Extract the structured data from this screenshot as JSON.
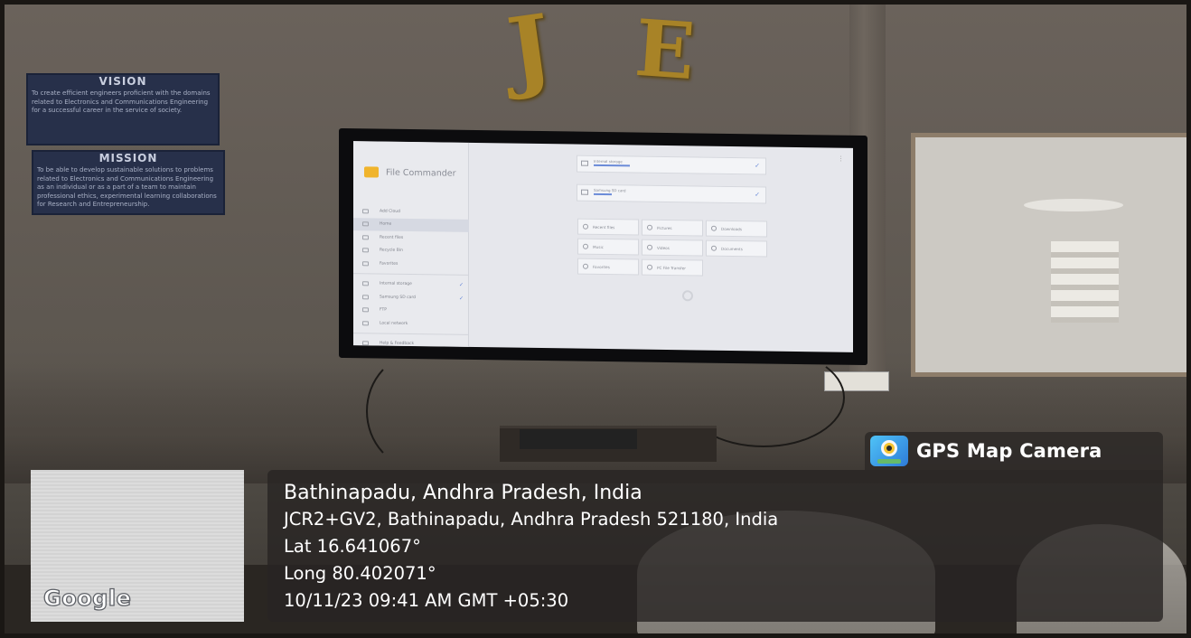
{
  "scene": {
    "balloons": [
      "J",
      "E"
    ],
    "vision_board": {
      "title": "VISION",
      "text": "To create efficient engineers proficient with the domains related to Electronics and Communications Engineering for a successful career in the service of society."
    },
    "mission_board": {
      "title": "MISSION",
      "text": "To be able to develop sustainable solutions to problems related to Electronics and Communications Engineering as an individual or as a part of a team to maintain professional ethics, experimental learning collaborations for Research and Entrepreneurship."
    }
  },
  "tv_screen": {
    "app_title": "File Commander",
    "sidebar": [
      {
        "label": "Add Cloud",
        "icon": "cloud-icon"
      },
      {
        "label": "Home",
        "icon": "home-icon",
        "active": true
      },
      {
        "label": "Recent files",
        "icon": "clock-icon"
      },
      {
        "label": "Recycle Bin",
        "icon": "trash-icon"
      },
      {
        "label": "Favorites",
        "icon": "star-icon"
      },
      {
        "label": "Internal storage",
        "icon": "storage-icon",
        "checked": true
      },
      {
        "label": "Samsung SD card",
        "icon": "sdcard-icon",
        "checked": true
      },
      {
        "label": "FTP",
        "icon": "ftp-icon"
      },
      {
        "label": "Local network",
        "icon": "network-icon"
      },
      {
        "label": "Help & Feedback",
        "icon": "help-icon"
      }
    ],
    "storage": [
      {
        "name": "Internal storage",
        "size": ""
      },
      {
        "name": "Samsung SD card",
        "size": ""
      }
    ],
    "tiles": [
      {
        "label": "Recent files"
      },
      {
        "label": "Pictures"
      },
      {
        "label": "Downloads"
      },
      {
        "label": "Music"
      },
      {
        "label": "Videos"
      },
      {
        "label": "Documents"
      },
      {
        "label": "Favorites"
      },
      {
        "label": "PC File Transfer"
      }
    ]
  },
  "overlay": {
    "map_label": "Google",
    "app_badge": "GPS Map Camera",
    "location_title": "Bathinapadu, Andhra Pradesh, India",
    "address": "JCR2+GV2, Bathinapadu, Andhra Pradesh 521180, India",
    "lat": "Lat 16.641067°",
    "long": "Long 80.402071°",
    "datetime": "10/11/23 09:41 AM GMT +05:30"
  }
}
